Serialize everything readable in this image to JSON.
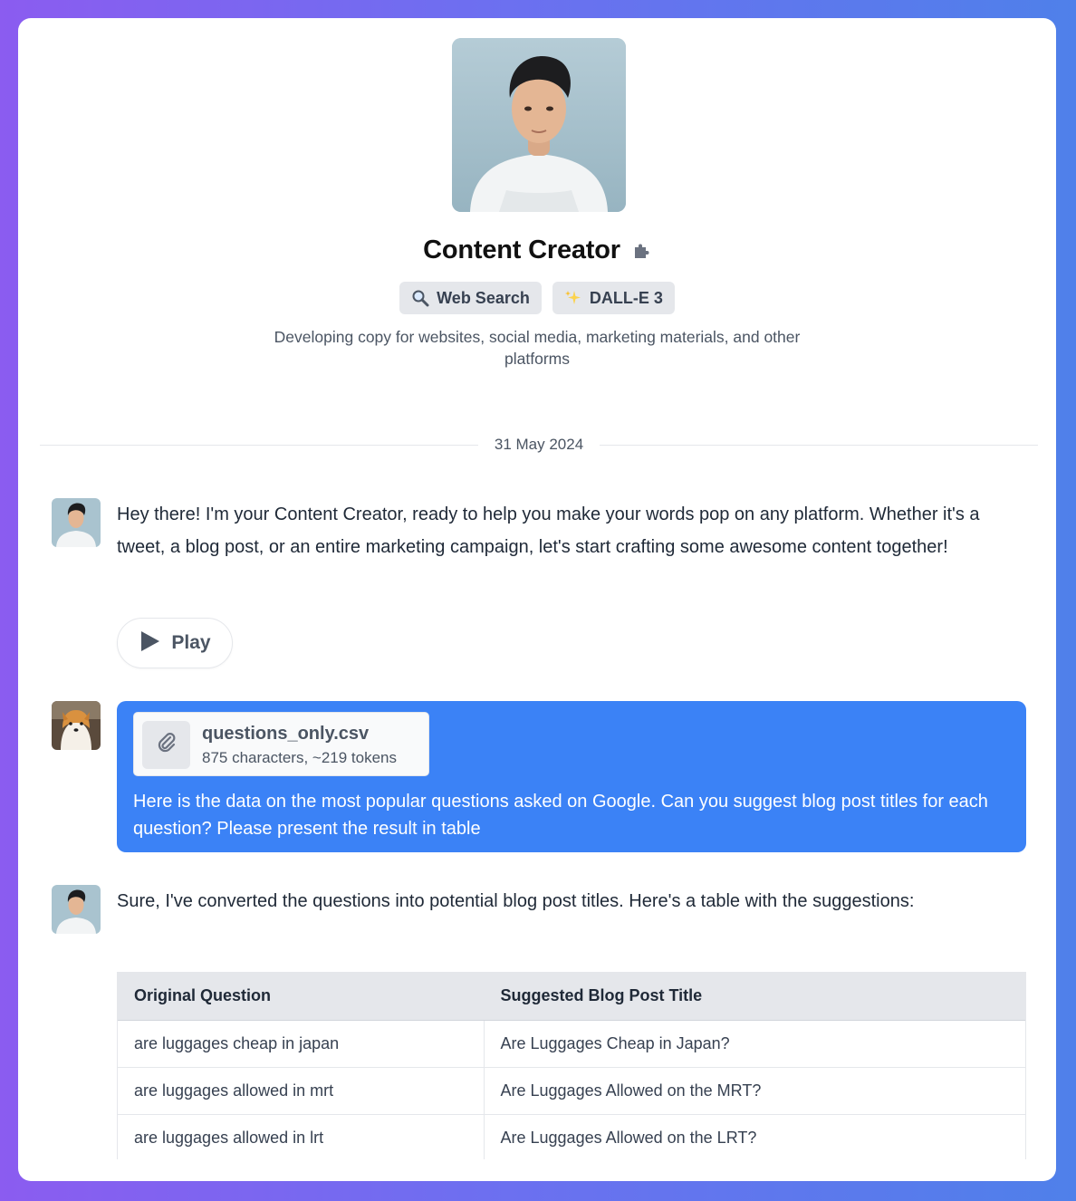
{
  "assistant": {
    "name": "Content Creator",
    "tools": [
      {
        "icon": "magnifier-icon",
        "label": "Web Search"
      },
      {
        "icon": "sparkle-icon",
        "label": "DALL-E 3"
      }
    ],
    "description": "Developing copy for websites, social media, marketing materials, and other platforms"
  },
  "conversation": {
    "date": "31 May 2024",
    "messages": [
      {
        "role": "assistant",
        "text": "Hey there! I'm your Content Creator, ready to help you make your words pop on any platform. Whether it's a tweet, a blog post, or an entire marketing campaign, let's start crafting some awesome content together!",
        "play_label": "Play"
      },
      {
        "role": "user",
        "attachment": {
          "name": "questions_only.csv",
          "meta": "875 characters, ~219 tokens"
        },
        "text": "Here is the data on the most popular questions asked on Google. Can you suggest blog post titles for each question? Please present the result in table"
      },
      {
        "role": "assistant",
        "text": "Sure, I've converted the questions into potential blog post titles. Here's a table with the suggestions:",
        "table": {
          "headers": [
            "Original Question",
            "Suggested Blog Post Title"
          ],
          "rows": [
            [
              "are luggages cheap in japan",
              "Are Luggages Cheap in Japan?"
            ],
            [
              "are luggages allowed in mrt",
              "Are Luggages Allowed on the MRT?"
            ],
            [
              "are luggages allowed in lrt",
              "Are Luggages Allowed on the LRT?"
            ]
          ]
        }
      }
    ]
  },
  "colors": {
    "user_bubble": "#3b82f6",
    "background_gradient_start": "#8b5cf0",
    "background_gradient_end": "#4f80ea"
  }
}
